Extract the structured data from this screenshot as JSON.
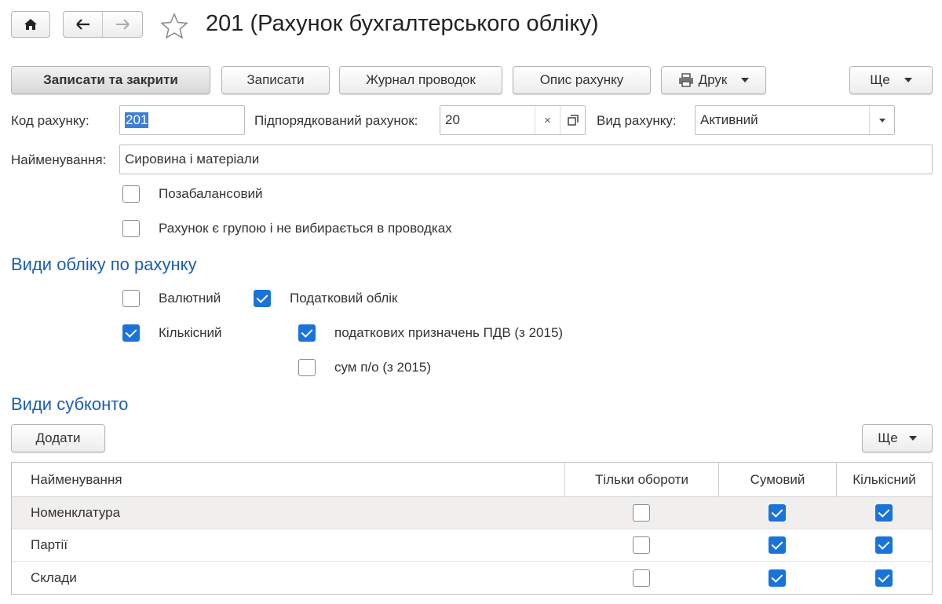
{
  "header": {
    "title": "201 (Рахунок бухгалтерського обліку)",
    "icons": {
      "home": "home-icon",
      "back": "arrow-left-icon",
      "forward": "arrow-right-icon",
      "favorite": "star-icon"
    }
  },
  "toolbar": {
    "save_close": "Записати та закрити",
    "save": "Записати",
    "journal": "Журнал проводок",
    "description": "Опис рахунку",
    "print": "Друк",
    "more": "Ще"
  },
  "form": {
    "code_label": "Код рахунку:",
    "code_value": "201",
    "parent_label": "Підпорядкований рахунок:",
    "parent_value": "20",
    "parent_clear": "×",
    "type_label": "Вид рахунку:",
    "type_value": "Активний",
    "name_label": "Найменування:",
    "name_value": "Сировина і матеріали",
    "off_balance_label": "Позабалансовий",
    "off_balance_checked": false,
    "group_label": "Рахунок є групою і не вибирається в проводках",
    "group_checked": false
  },
  "accounting": {
    "title": "Види обліку по рахунку",
    "currency_label": "Валютний",
    "currency_checked": false,
    "tax_label": "Податковий облік",
    "tax_checked": true,
    "quantity_label": "Кількісний",
    "quantity_checked": true,
    "vat_label": "податкових призначень ПДВ (з 2015)",
    "vat_checked": true,
    "sum_label": "сум п/о (з 2015)",
    "sum_checked": false
  },
  "subconto": {
    "title": "Види субконто",
    "add_label": "Додати",
    "more_label": "Ще",
    "columns": [
      "Найменування",
      "Тільки обороти",
      "Сумовий",
      "Кількісний"
    ],
    "rows": [
      {
        "name": "Номенклатура",
        "turnover": false,
        "sum": true,
        "qty": true
      },
      {
        "name": "Партії",
        "turnover": false,
        "sum": true,
        "qty": true
      },
      {
        "name": "Склади",
        "turnover": false,
        "sum": true,
        "qty": true
      }
    ]
  },
  "colors": {
    "accent": "#1a73d9",
    "section_title": "#1a5fb4",
    "selected_row": "#f1efed"
  }
}
